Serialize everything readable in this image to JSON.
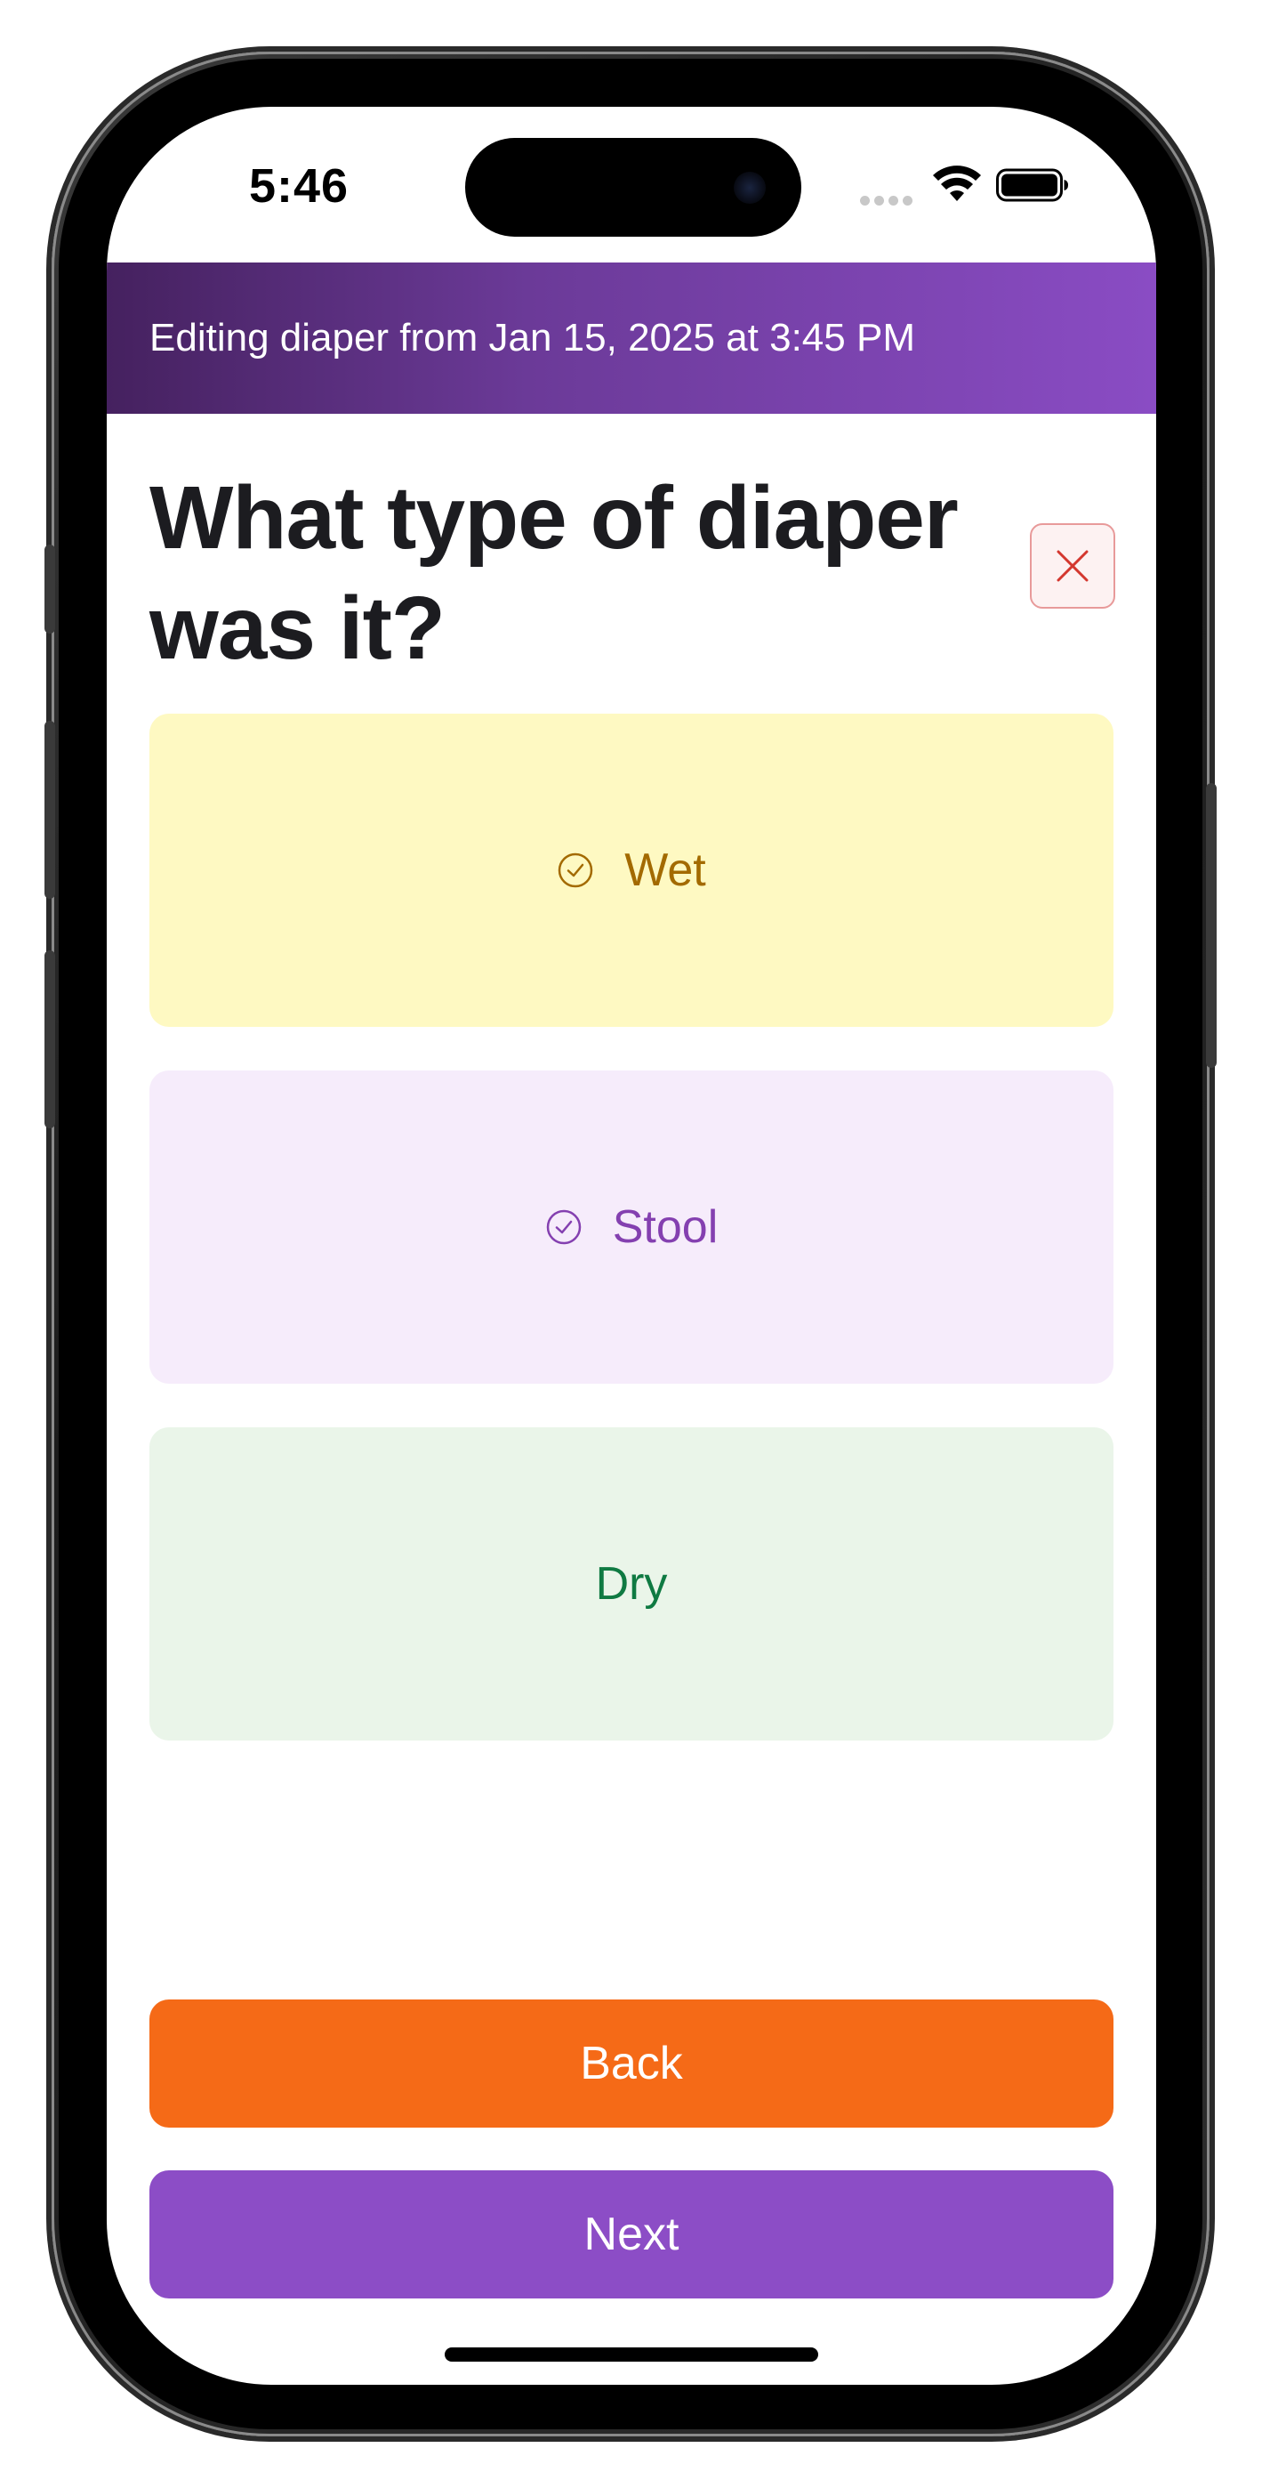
{
  "status_bar": {
    "time": "5:46",
    "icons": [
      "signal-dots-icon",
      "wifi-icon",
      "battery-icon"
    ]
  },
  "banner": {
    "text": "Editing diaper from Jan 15, 2025 at 3:45 PM",
    "gradient_colors": [
      "#45215f",
      "#8a4cc4"
    ]
  },
  "question": {
    "title": "What type of diaper was it?",
    "close_icon": "close-icon"
  },
  "options": [
    {
      "label": "Wet",
      "icon": "check-circle-icon",
      "bg": "#fef9c2",
      "color": "#a36a00"
    },
    {
      "label": "Stool",
      "icon": "check-circle-icon",
      "bg": "#f6ecfb",
      "color": "#8440b0"
    },
    {
      "label": "Dry",
      "icon": null,
      "bg": "#eaf5e9",
      "color": "#0f7a42"
    }
  ],
  "actions": {
    "back_label": "Back",
    "back_color": "#f56a17",
    "next_label": "Next",
    "next_color": "#8c4dc6"
  }
}
